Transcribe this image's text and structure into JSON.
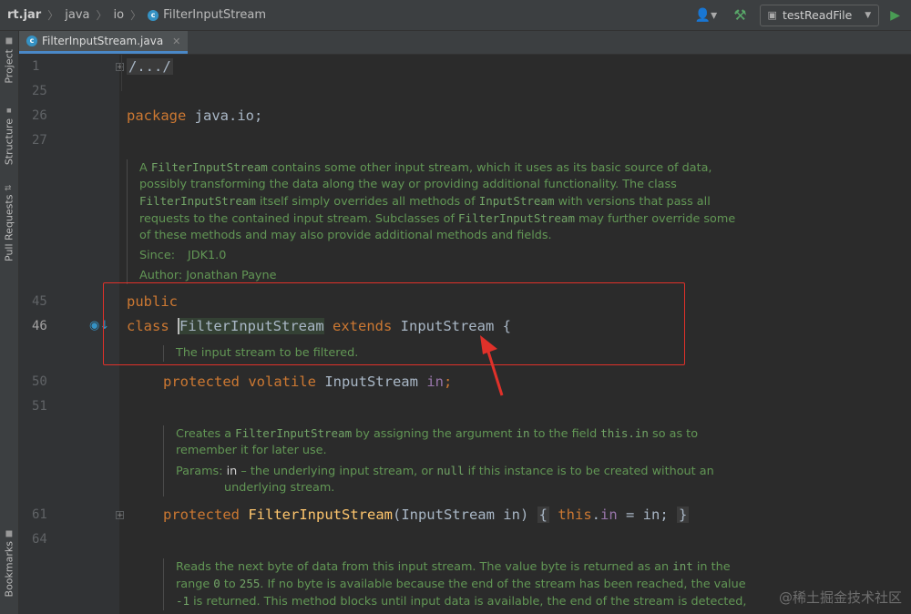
{
  "breadcrumb": {
    "items": [
      "rt.jar",
      "java",
      "io",
      "FilterInputStream"
    ],
    "separator": "〉"
  },
  "toolbar": {
    "run_config": "testReadFile"
  },
  "side_tabs": {
    "project": "Project",
    "structure": "Structure",
    "pull_requests": "Pull Requests",
    "bookmarks": "Bookmarks"
  },
  "editor_tab": {
    "filename": "FilterInputStream.java"
  },
  "line_numbers": [
    "1",
    "25",
    "26",
    "27",
    "45",
    "46",
    "50",
    "51",
    "61",
    "64"
  ],
  "code": {
    "folded_header": "/.../",
    "pkg_kw": "package",
    "pkg_name": " java.io;",
    "public_kw": "public",
    "class_kw": "class",
    "class_name": "FilterInputStream",
    "extends_kw": " extends ",
    "super_name": "InputStream",
    "brace": " {",
    "l50_kw": "protected volatile",
    "l50_type": " InputStream ",
    "l50_field": "in",
    "l50_semi": ";",
    "l61_kw": "protected",
    "l61_ctor": "FilterInputStream",
    "l61_params": "(InputStream in)",
    "l61_open": "{",
    "l61_this": "this",
    "l61_dot": ".",
    "l61_field": "in",
    "l61_assign": " = in;",
    "l61_close": "}"
  },
  "doc1": {
    "l1a": "A ",
    "l1m": "FilterInputStream",
    "l1b": " contains some other input stream, which it uses as its basic source of data,",
    "l2": "possibly transforming the data along the way or providing additional functionality. The class",
    "l3m": "FilterInputStream",
    "l3b": " itself simply overrides all methods of ",
    "l3m2": "InputStream",
    "l3c": " with versions that pass all",
    "l4a": "requests to the contained input stream. Subclasses of ",
    "l4m": "FilterInputStream",
    "l4b": " may further override some",
    "l5": "of these methods and may also provide additional methods and fields.",
    "since_label": "Since:",
    "since_value": "JDK1.0",
    "author": "Author: Jonathan Payne"
  },
  "doc2": {
    "text": "The input stream to be filtered."
  },
  "doc3": {
    "l1a": "Creates a ",
    "l1m": "FilterInputStream",
    "l1b": " by assigning the argument ",
    "l1m2": "in",
    "l1c": " to the field ",
    "l1m3": "this.in",
    "l1d": " so as to",
    "l2": "remember it for later use.",
    "params_label": "Params:",
    "p1a": "in",
    "p1b": " – the underlying input stream, or ",
    "p1m": "null",
    "p1c": " if this instance is to be created without an",
    "p2": "underlying stream."
  },
  "doc4": {
    "l1a": "Reads the next byte of data from this input stream. The value byte is returned as an ",
    "l1m": "int",
    "l1b": " in the",
    "l2a": "range ",
    "l2m": "0",
    "l2b": " to ",
    "l2m2": "255",
    "l2c": ". If no byte is available because the end of the stream has been reached, the value",
    "l3m": "-1",
    "l3b": " is returned. This method blocks until input data is available, the end of the stream is detected,"
  },
  "watermark": "@稀土掘金技术社区",
  "colors": {
    "background": "#2b2b2b",
    "keyword": "#cc7832",
    "doc_text": "#629755",
    "annotation": "#e0312a"
  }
}
